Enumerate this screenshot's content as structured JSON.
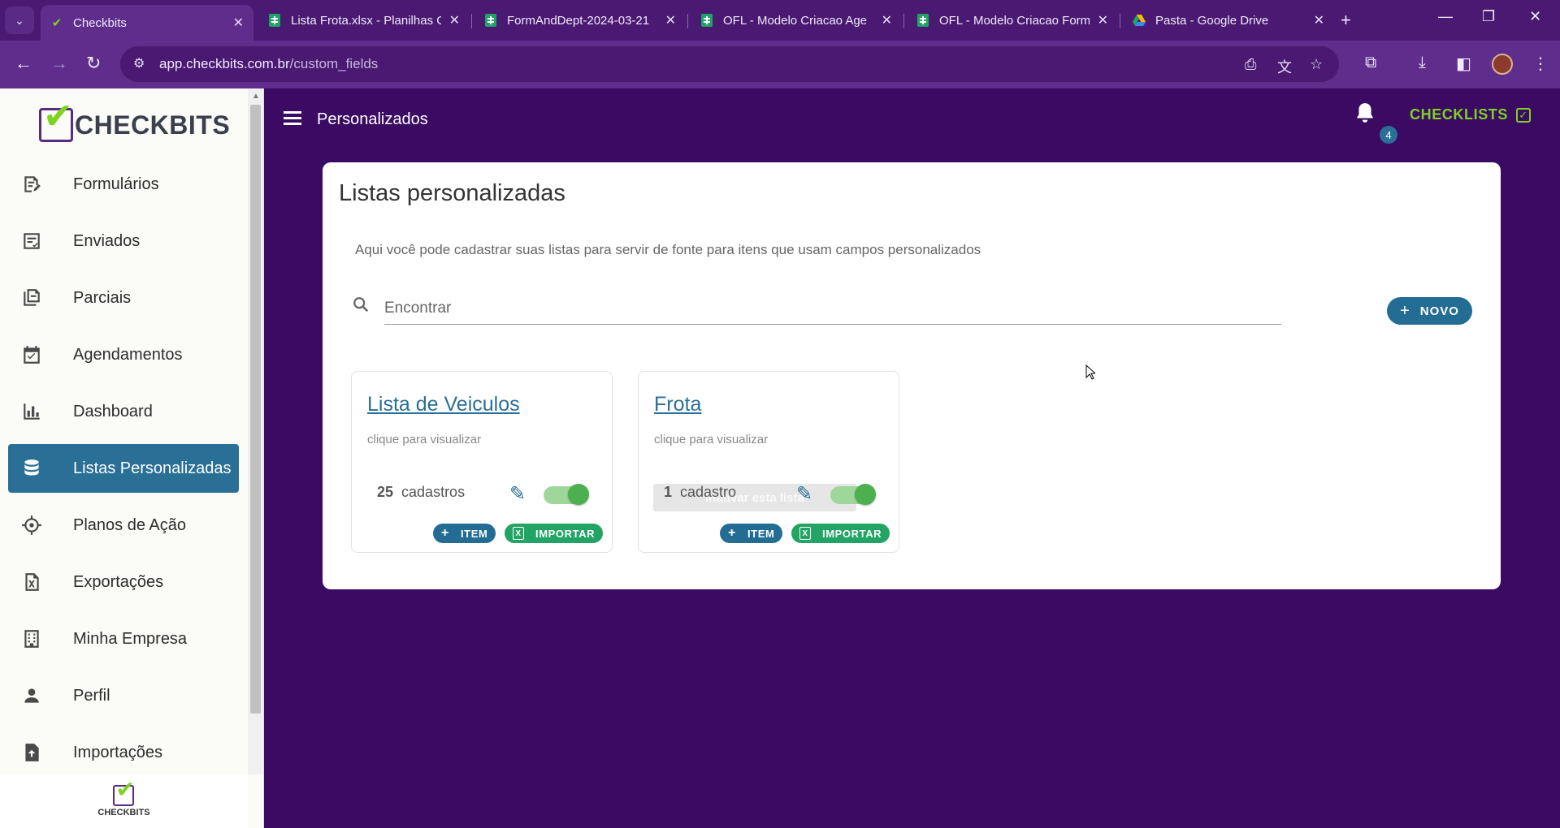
{
  "browser": {
    "tabs": [
      {
        "title": "Checkbits",
        "active": true
      },
      {
        "title": "Lista Frota.xlsx - Planilhas G"
      },
      {
        "title": "FormAndDept-2024-03-21"
      },
      {
        "title": "OFL - Modelo Criacao Age"
      },
      {
        "title": "OFL - Modelo Criacao Form"
      },
      {
        "title": "Pasta - Google Drive"
      }
    ],
    "url_host": "app.checkbits.com.br",
    "url_path": "/custom_fields"
  },
  "sidebar": {
    "logo_text": "CHECKBITS",
    "footer_logo_text": "CHECKBITS",
    "items": [
      {
        "label": "Formulários",
        "icon": "form-edit-icon"
      },
      {
        "label": "Enviados",
        "icon": "sent-list-icon"
      },
      {
        "label": "Parciais",
        "icon": "partial-docs-icon"
      },
      {
        "label": "Agendamentos",
        "icon": "calendar-icon"
      },
      {
        "label": "Dashboard",
        "icon": "bar-chart-icon"
      },
      {
        "label": "Listas Personalizadas",
        "icon": "database-icon",
        "active": true
      },
      {
        "label": "Planos de Ação",
        "icon": "target-icon"
      },
      {
        "label": "Exportações",
        "icon": "excel-file-icon"
      },
      {
        "label": "Minha Empresa",
        "icon": "building-icon"
      },
      {
        "label": "Perfil",
        "icon": "person-icon"
      },
      {
        "label": "Importações",
        "icon": "file-upload-icon"
      }
    ]
  },
  "header": {
    "title": "Personalizados",
    "notification_count": "4",
    "checklists_label": "CHECKLISTS"
  },
  "main": {
    "title": "Listas personalizadas",
    "description": "Aqui você pode cadastrar suas listas para servir de fonte para itens que usam campos personalizados",
    "search_placeholder": "Encontrar",
    "new_button": "NOVO",
    "lists": [
      {
        "name": "Lista de Veiculos",
        "subtitle": "clique para visualizar",
        "count": "25",
        "count_label": "cadastros",
        "enabled": true,
        "item_button": "ITEM",
        "import_button": "IMPORTAR"
      },
      {
        "name": "Frota",
        "subtitle": "clique para visualizar",
        "count": "1",
        "count_label": "cadastro",
        "enabled": true,
        "tooltip": "Inativar esta lista",
        "item_button": "ITEM",
        "import_button": "IMPORTAR"
      }
    ]
  },
  "colors": {
    "brand_purple": "#3b0a63",
    "accent_blue": "#236d95",
    "accent_green": "#7ed321",
    "import_green": "#21a464"
  }
}
